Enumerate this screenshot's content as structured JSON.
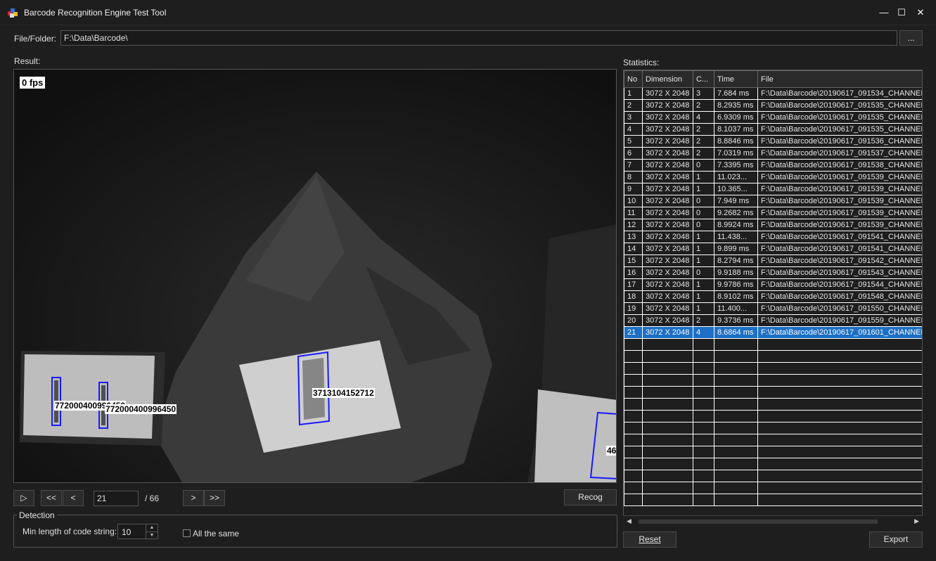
{
  "window": {
    "title": "Barcode Recognition Engine Test Tool",
    "minimize": "—",
    "maximize": "☐",
    "close": "✕"
  },
  "file": {
    "label": "File/Folder:",
    "value": "F:\\Data\\Barcode\\",
    "browse_label": "..."
  },
  "result": {
    "label": "Result:",
    "fps": "0 fps",
    "detections": [
      "772000400996450",
      "772000400996450",
      "3713104152712",
      "46"
    ]
  },
  "statistics": {
    "label": "Statistics:",
    "columns": [
      "No",
      "Dimension",
      "C...",
      "Time",
      "File"
    ],
    "rows": [
      [
        "1",
        "3072 X 2048",
        "3",
        "7.684 ms",
        "F:\\Data\\Barcode\\20190617_091534_CHANNEL_"
      ],
      [
        "2",
        "3072 X 2048",
        "2",
        "8.2935 ms",
        "F:\\Data\\Barcode\\20190617_091535_CHANNEL_"
      ],
      [
        "3",
        "3072 X 2048",
        "4",
        "6.9309 ms",
        "F:\\Data\\Barcode\\20190617_091535_CHANNEL_"
      ],
      [
        "4",
        "3072 X 2048",
        "2",
        "8.1037 ms",
        "F:\\Data\\Barcode\\20190617_091535_CHANNEL_"
      ],
      [
        "5",
        "3072 X 2048",
        "2",
        "8.8846 ms",
        "F:\\Data\\Barcode\\20190617_091536_CHANNEL_"
      ],
      [
        "6",
        "3072 X 2048",
        "2",
        "7.0319 ms",
        "F:\\Data\\Barcode\\20190617_091537_CHANNEL_"
      ],
      [
        "7",
        "3072 X 2048",
        "0",
        "7.3395 ms",
        "F:\\Data\\Barcode\\20190617_091538_CHANNEL_"
      ],
      [
        "8",
        "3072 X 2048",
        "1",
        "11.023...",
        "F:\\Data\\Barcode\\20190617_091539_CHANNEL_"
      ],
      [
        "9",
        "3072 X 2048",
        "1",
        "10.365...",
        "F:\\Data\\Barcode\\20190617_091539_CHANNEL_"
      ],
      [
        "10",
        "3072 X 2048",
        "0",
        "7.949 ms",
        "F:\\Data\\Barcode\\20190617_091539_CHANNEL_"
      ],
      [
        "11",
        "3072 X 2048",
        "0",
        "9.2682 ms",
        "F:\\Data\\Barcode\\20190617_091539_CHANNEL_"
      ],
      [
        "12",
        "3072 X 2048",
        "0",
        "8.9924 ms",
        "F:\\Data\\Barcode\\20190617_091539_CHANNEL_"
      ],
      [
        "13",
        "3072 X 2048",
        "1",
        "11.438...",
        "F:\\Data\\Barcode\\20190617_091541_CHANNEL_"
      ],
      [
        "14",
        "3072 X 2048",
        "1",
        "9.899 ms",
        "F:\\Data\\Barcode\\20190617_091541_CHANNEL_"
      ],
      [
        "15",
        "3072 X 2048",
        "1",
        "8.2794 ms",
        "F:\\Data\\Barcode\\20190617_091542_CHANNEL_"
      ],
      [
        "16",
        "3072 X 2048",
        "0",
        "9.9188 ms",
        "F:\\Data\\Barcode\\20190617_091543_CHANNEL_"
      ],
      [
        "17",
        "3072 X 2048",
        "1",
        "9.9786 ms",
        "F:\\Data\\Barcode\\20190617_091544_CHANNEL_"
      ],
      [
        "18",
        "3072 X 2048",
        "1",
        "8.9102 ms",
        "F:\\Data\\Barcode\\20190617_091548_CHANNEL_"
      ],
      [
        "19",
        "3072 X 2048",
        "1",
        "11.400...",
        "F:\\Data\\Barcode\\20190617_091550_CHANNEL_"
      ],
      [
        "20",
        "3072 X 2048",
        "2",
        "9.3736 ms",
        "F:\\Data\\Barcode\\20190617_091559_CHANNEL_"
      ],
      [
        "21",
        "3072 X 2048",
        "4",
        "8.6864 ms",
        "F:\\Data\\Barcode\\20190617_091601_CHANNEL_"
      ]
    ],
    "selected_row": "21",
    "reset_label": "Reset",
    "export_label": "Export"
  },
  "nav": {
    "play": "▷",
    "first": "<<",
    "prev": "<",
    "page": "21",
    "total": "/ 66",
    "next": ">",
    "last": ">>",
    "recog_label": "Recog"
  },
  "detection": {
    "title": "Detection",
    "min_len_label": "Min length of code string:",
    "min_len_value": "10",
    "all_same_label": "All the same"
  },
  "colors": {
    "accent": "#1c6fc4",
    "box": "#1a1aff"
  }
}
